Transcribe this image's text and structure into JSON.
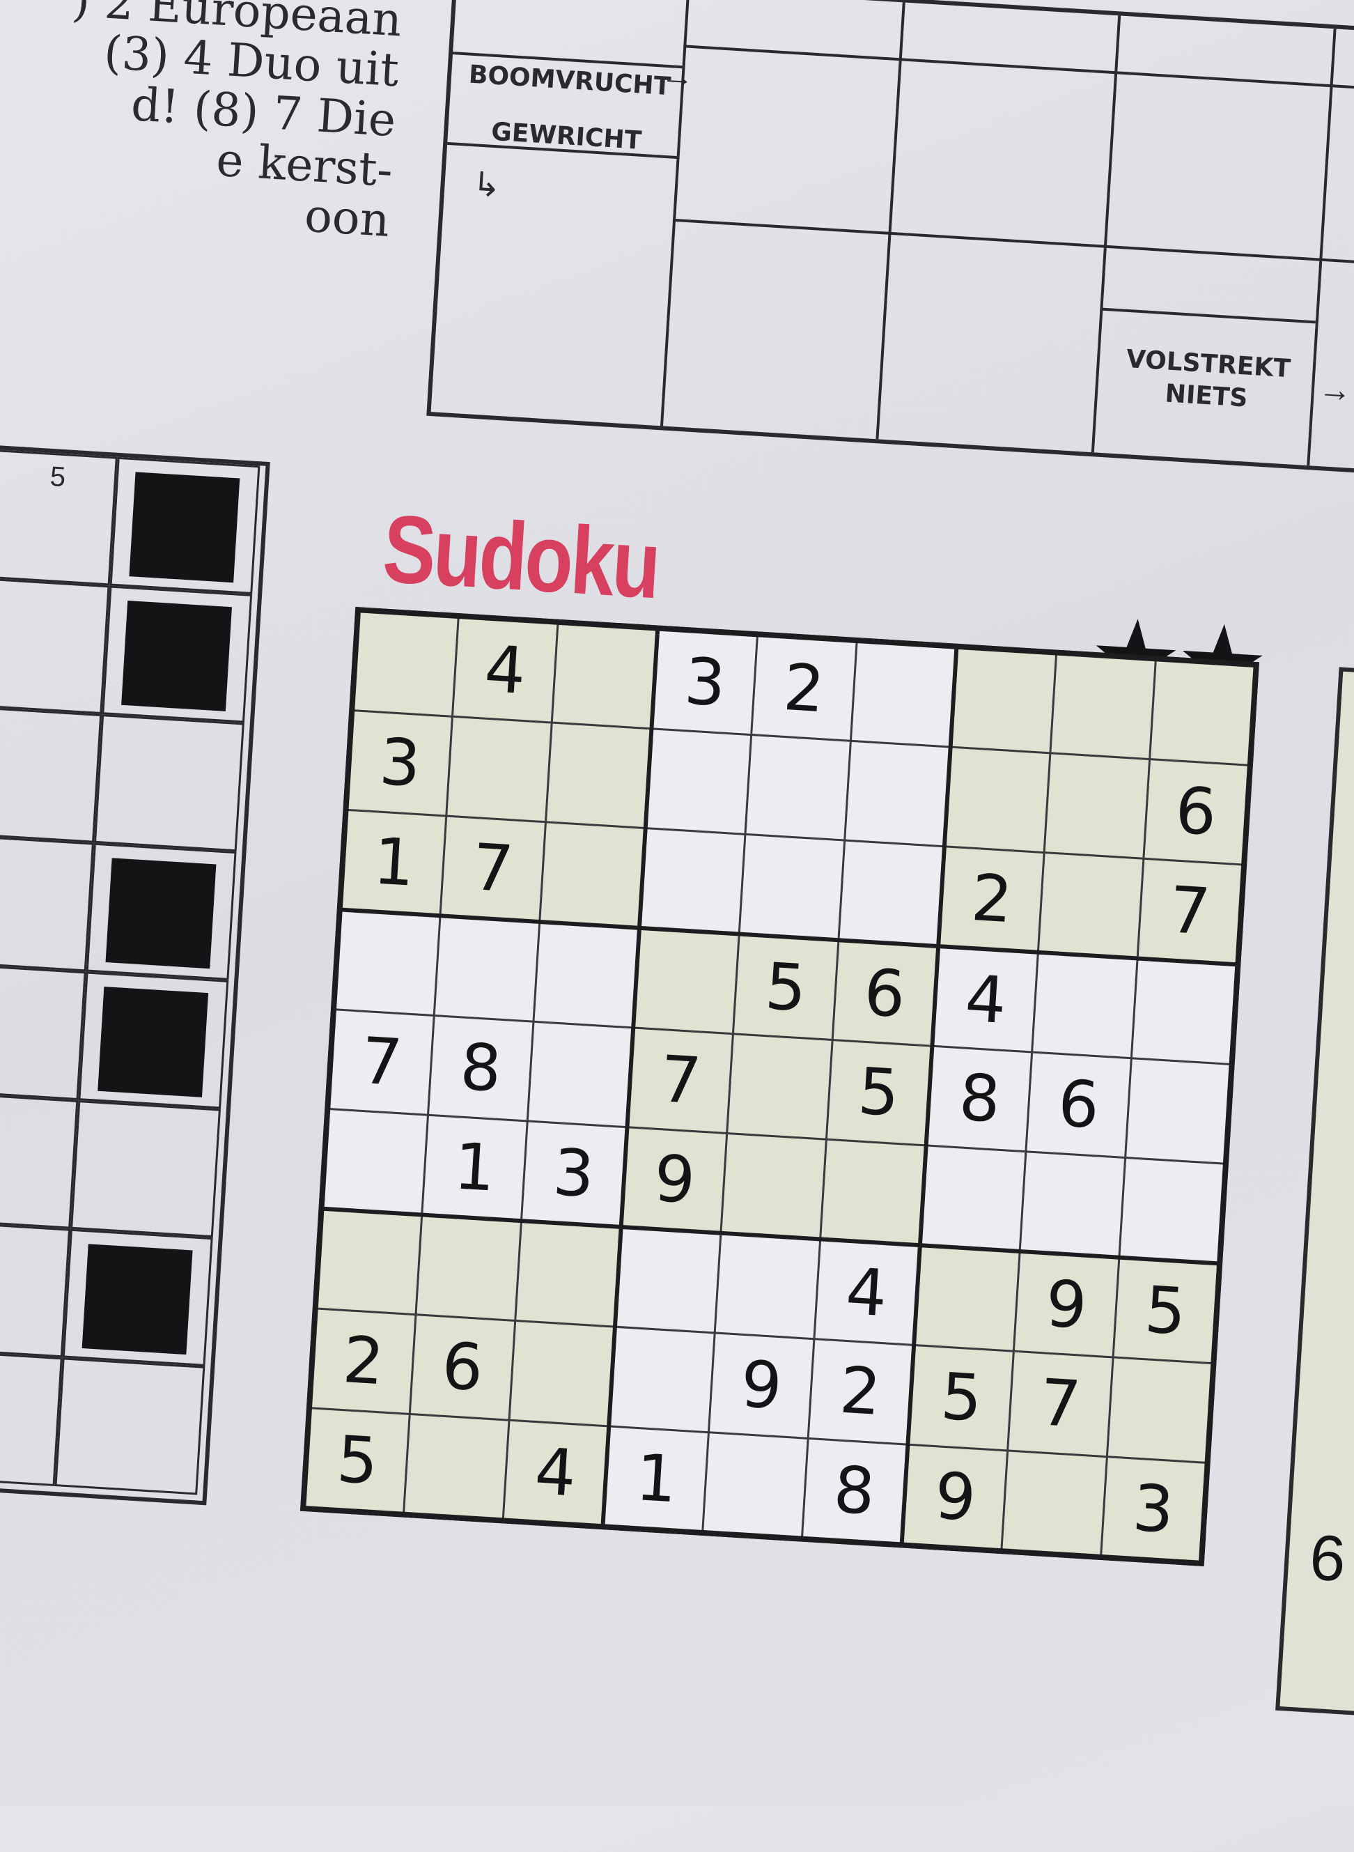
{
  "clue_text": {
    "lines": [
      ") 2 Europeaan",
      "(3) 4 Duo uit",
      "d! (8) 7 Die",
      "e kerst-",
      "oon"
    ]
  },
  "arrow_grid": {
    "labels": {
      "boomvrucht": "BOOMVRUCHT",
      "gewricht": "GEWRICHT",
      "volstrekt_niets": [
        "VOLSTREKT",
        "NIETS"
      ]
    }
  },
  "left_grid": {
    "number": "5"
  },
  "sudoku": {
    "title": "Sudoku",
    "difficulty_stars": "★★",
    "title_color": "#d8405f",
    "tinted_boxes": [
      0,
      2,
      4,
      6,
      8
    ],
    "grid": [
      [
        "",
        "4",
        "",
        "3",
        "2",
        "",
        "",
        "",
        ""
      ],
      [
        "3",
        "",
        "",
        "",
        "",
        "",
        "",
        "",
        "6"
      ],
      [
        "1",
        "7",
        "",
        "",
        "",
        "",
        "2",
        "",
        "7"
      ],
      [
        "",
        "",
        "",
        "",
        "5",
        "6",
        "4",
        "",
        ""
      ],
      [
        "7",
        "8",
        "",
        "7",
        "",
        "5",
        "8",
        "6",
        ""
      ],
      [
        "",
        "1",
        "3",
        "9",
        "",
        "",
        "",
        "",
        ""
      ],
      [
        "",
        "",
        "",
        "",
        "",
        "4",
        "",
        "9",
        "5"
      ],
      [
        "2",
        "6",
        "",
        "",
        "9",
        "2",
        "5",
        "7",
        ""
      ],
      [
        "5",
        "",
        "4",
        "1",
        "",
        "8",
        "9",
        "",
        "3"
      ]
    ]
  },
  "right_grid": {
    "number": "6"
  }
}
